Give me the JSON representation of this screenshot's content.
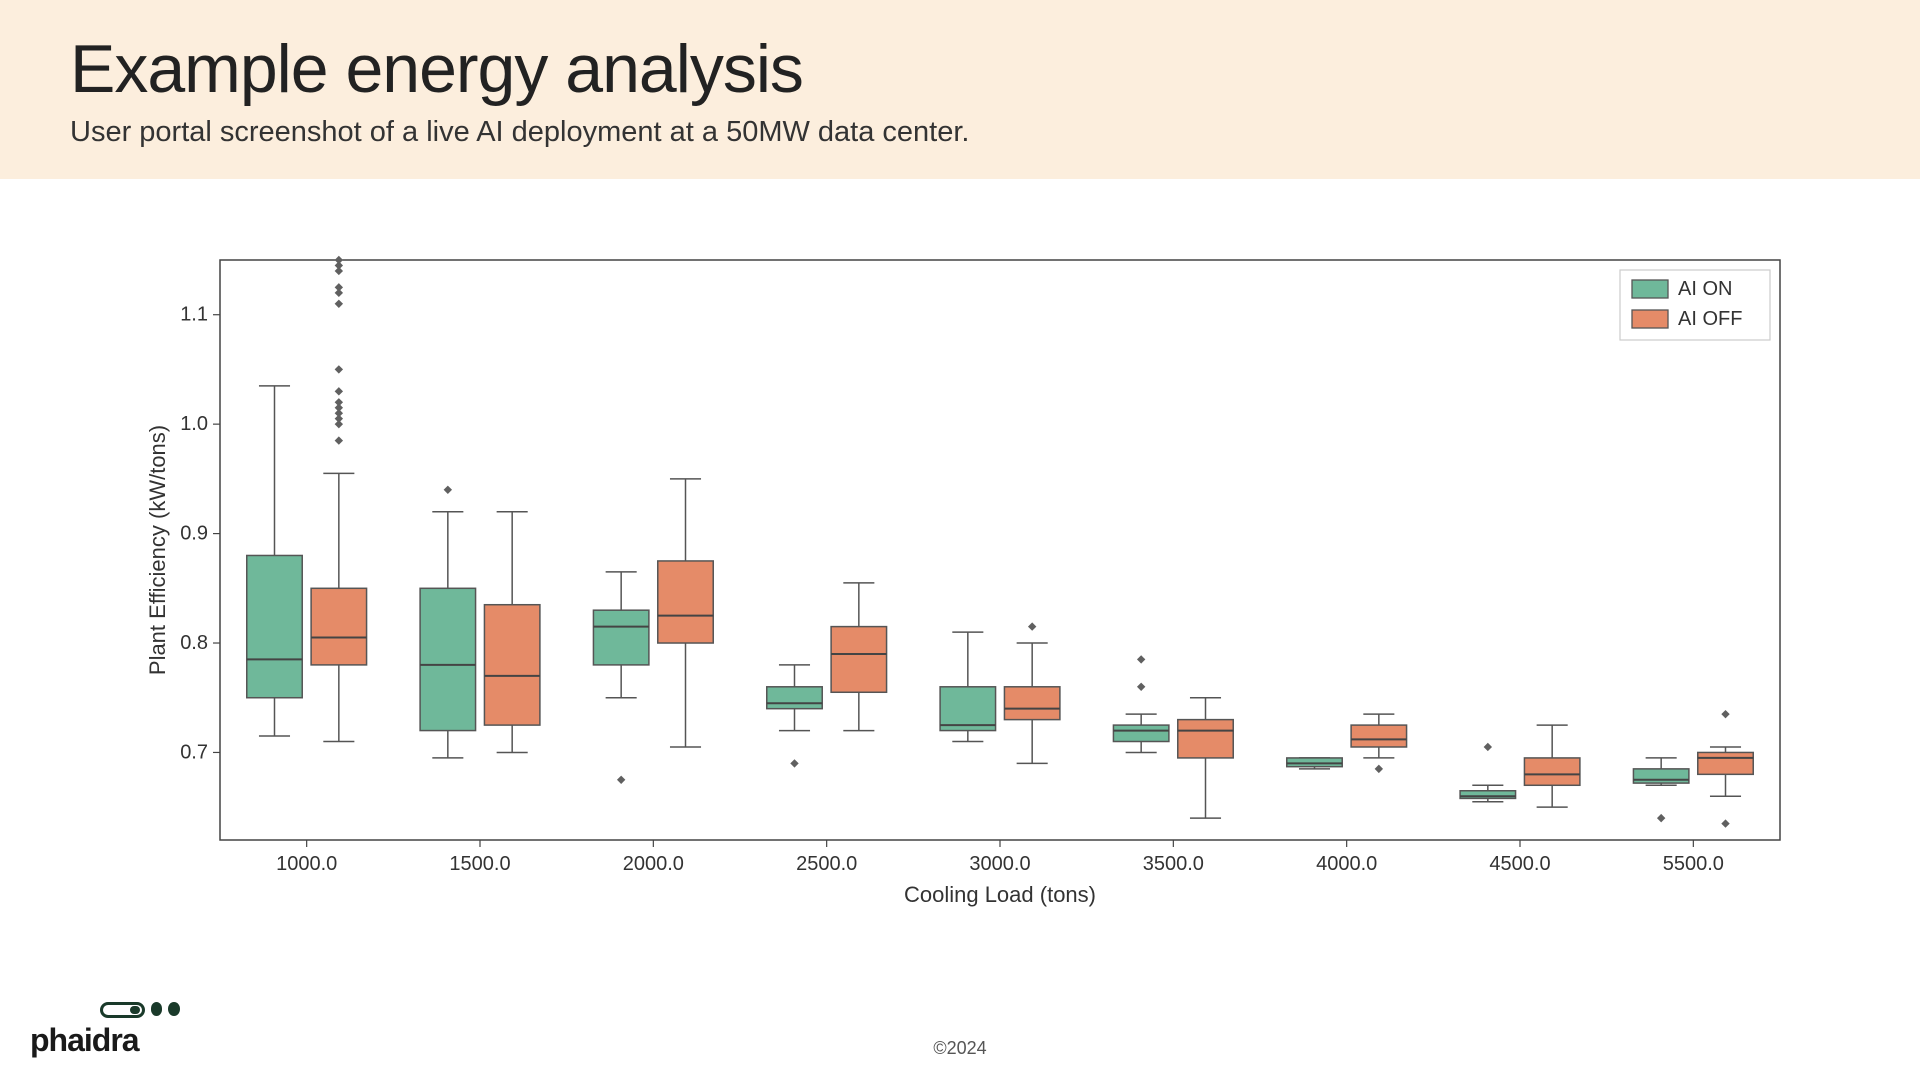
{
  "header": {
    "title": "Example energy analysis",
    "subtitle": "User portal screenshot of a live AI deployment at a 50MW data center."
  },
  "footer": {
    "copyright": "©2024",
    "logo_text": "phaidra"
  },
  "chart_data": {
    "type": "boxplot",
    "xlabel": "Cooling Load (tons)",
    "ylabel": "Plant Efficiency (kW/tons)",
    "ylim": [
      0.62,
      1.15
    ],
    "yticks": [
      0.7,
      0.8,
      0.9,
      1.0,
      1.1
    ],
    "categories": [
      "1000.0",
      "1500.0",
      "2000.0",
      "2500.0",
      "3000.0",
      "3500.0",
      "4000.0",
      "4500.0",
      "5500.0"
    ],
    "legend": [
      "AI ON",
      "AI OFF"
    ],
    "colors": {
      "AI ON": "#6FB89A",
      "AI OFF": "#E58B68"
    },
    "series": [
      {
        "name": "AI ON",
        "boxes": [
          {
            "whisker_low": 0.715,
            "q1": 0.75,
            "median": 0.785,
            "q3": 0.88,
            "whisker_high": 1.035,
            "outliers": []
          },
          {
            "whisker_low": 0.695,
            "q1": 0.72,
            "median": 0.78,
            "q3": 0.85,
            "whisker_high": 0.92,
            "outliers": [
              0.94
            ]
          },
          {
            "whisker_low": 0.75,
            "q1": 0.78,
            "median": 0.815,
            "q3": 0.83,
            "whisker_high": 0.865,
            "outliers": [
              0.675
            ]
          },
          {
            "whisker_low": 0.72,
            "q1": 0.74,
            "median": 0.745,
            "q3": 0.76,
            "whisker_high": 0.78,
            "outliers": [
              0.69
            ]
          },
          {
            "whisker_low": 0.71,
            "q1": 0.72,
            "median": 0.725,
            "q3": 0.76,
            "whisker_high": 0.81,
            "outliers": []
          },
          {
            "whisker_low": 0.7,
            "q1": 0.71,
            "median": 0.72,
            "q3": 0.725,
            "whisker_high": 0.735,
            "outliers": [
              0.785,
              0.76
            ]
          },
          {
            "whisker_low": 0.685,
            "q1": 0.687,
            "median": 0.69,
            "q3": 0.695,
            "whisker_high": 0.695,
            "outliers": []
          },
          {
            "whisker_low": 0.655,
            "q1": 0.658,
            "median": 0.66,
            "q3": 0.665,
            "whisker_high": 0.67,
            "outliers": [
              0.705
            ]
          },
          {
            "whisker_low": 0.67,
            "q1": 0.672,
            "median": 0.675,
            "q3": 0.685,
            "whisker_high": 0.695,
            "outliers": [
              0.64
            ]
          }
        ]
      },
      {
        "name": "AI OFF",
        "boxes": [
          {
            "whisker_low": 0.71,
            "q1": 0.78,
            "median": 0.805,
            "q3": 0.85,
            "whisker_high": 0.955,
            "outliers": [
              0.985,
              1.0,
              1.005,
              1.01,
              1.015,
              1.02,
              1.03,
              1.05,
              1.11,
              1.12,
              1.125,
              1.14,
              1.145,
              1.15
            ]
          },
          {
            "whisker_low": 0.7,
            "q1": 0.725,
            "median": 0.77,
            "q3": 0.835,
            "whisker_high": 0.92,
            "outliers": []
          },
          {
            "whisker_low": 0.705,
            "q1": 0.8,
            "median": 0.825,
            "q3": 0.875,
            "whisker_high": 0.95,
            "outliers": []
          },
          {
            "whisker_low": 0.72,
            "q1": 0.755,
            "median": 0.79,
            "q3": 0.815,
            "whisker_high": 0.855,
            "outliers": []
          },
          {
            "whisker_low": 0.69,
            "q1": 0.73,
            "median": 0.74,
            "q3": 0.76,
            "whisker_high": 0.8,
            "outliers": [
              0.815
            ]
          },
          {
            "whisker_low": 0.64,
            "q1": 0.695,
            "median": 0.72,
            "q3": 0.73,
            "whisker_high": 0.75,
            "outliers": []
          },
          {
            "whisker_low": 0.695,
            "q1": 0.705,
            "median": 0.712,
            "q3": 0.725,
            "whisker_high": 0.735,
            "outliers": [
              0.685
            ]
          },
          {
            "whisker_low": 0.65,
            "q1": 0.67,
            "median": 0.68,
            "q3": 0.695,
            "whisker_high": 0.725,
            "outliers": []
          },
          {
            "whisker_low": 0.66,
            "q1": 0.68,
            "median": 0.695,
            "q3": 0.7,
            "whisker_high": 0.705,
            "outliers": [
              0.735,
              0.635
            ]
          }
        ]
      }
    ]
  }
}
